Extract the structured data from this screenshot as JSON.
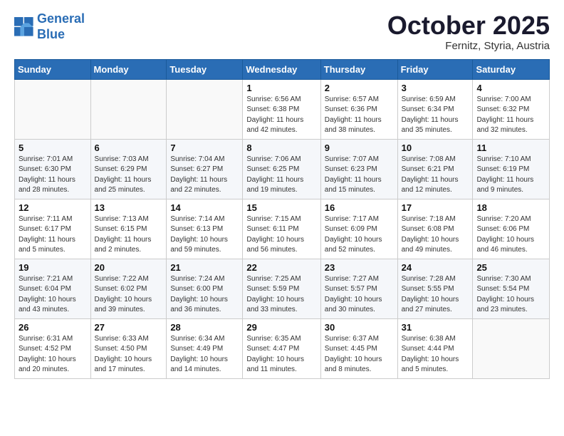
{
  "logo": {
    "line1": "General",
    "line2": "Blue"
  },
  "title": "October 2025",
  "subtitle": "Fernitz, Styria, Austria",
  "weekdays": [
    "Sunday",
    "Monday",
    "Tuesday",
    "Wednesday",
    "Thursday",
    "Friday",
    "Saturday"
  ],
  "weeks": [
    [
      {
        "day": "",
        "info": ""
      },
      {
        "day": "",
        "info": ""
      },
      {
        "day": "",
        "info": ""
      },
      {
        "day": "1",
        "info": "Sunrise: 6:56 AM\nSunset: 6:38 PM\nDaylight: 11 hours\nand 42 minutes."
      },
      {
        "day": "2",
        "info": "Sunrise: 6:57 AM\nSunset: 6:36 PM\nDaylight: 11 hours\nand 38 minutes."
      },
      {
        "day": "3",
        "info": "Sunrise: 6:59 AM\nSunset: 6:34 PM\nDaylight: 11 hours\nand 35 minutes."
      },
      {
        "day": "4",
        "info": "Sunrise: 7:00 AM\nSunset: 6:32 PM\nDaylight: 11 hours\nand 32 minutes."
      }
    ],
    [
      {
        "day": "5",
        "info": "Sunrise: 7:01 AM\nSunset: 6:30 PM\nDaylight: 11 hours\nand 28 minutes."
      },
      {
        "day": "6",
        "info": "Sunrise: 7:03 AM\nSunset: 6:29 PM\nDaylight: 11 hours\nand 25 minutes."
      },
      {
        "day": "7",
        "info": "Sunrise: 7:04 AM\nSunset: 6:27 PM\nDaylight: 11 hours\nand 22 minutes."
      },
      {
        "day": "8",
        "info": "Sunrise: 7:06 AM\nSunset: 6:25 PM\nDaylight: 11 hours\nand 19 minutes."
      },
      {
        "day": "9",
        "info": "Sunrise: 7:07 AM\nSunset: 6:23 PM\nDaylight: 11 hours\nand 15 minutes."
      },
      {
        "day": "10",
        "info": "Sunrise: 7:08 AM\nSunset: 6:21 PM\nDaylight: 11 hours\nand 12 minutes."
      },
      {
        "day": "11",
        "info": "Sunrise: 7:10 AM\nSunset: 6:19 PM\nDaylight: 11 hours\nand 9 minutes."
      }
    ],
    [
      {
        "day": "12",
        "info": "Sunrise: 7:11 AM\nSunset: 6:17 PM\nDaylight: 11 hours\nand 5 minutes."
      },
      {
        "day": "13",
        "info": "Sunrise: 7:13 AM\nSunset: 6:15 PM\nDaylight: 11 hours\nand 2 minutes."
      },
      {
        "day": "14",
        "info": "Sunrise: 7:14 AM\nSunset: 6:13 PM\nDaylight: 10 hours\nand 59 minutes."
      },
      {
        "day": "15",
        "info": "Sunrise: 7:15 AM\nSunset: 6:11 PM\nDaylight: 10 hours\nand 56 minutes."
      },
      {
        "day": "16",
        "info": "Sunrise: 7:17 AM\nSunset: 6:09 PM\nDaylight: 10 hours\nand 52 minutes."
      },
      {
        "day": "17",
        "info": "Sunrise: 7:18 AM\nSunset: 6:08 PM\nDaylight: 10 hours\nand 49 minutes."
      },
      {
        "day": "18",
        "info": "Sunrise: 7:20 AM\nSunset: 6:06 PM\nDaylight: 10 hours\nand 46 minutes."
      }
    ],
    [
      {
        "day": "19",
        "info": "Sunrise: 7:21 AM\nSunset: 6:04 PM\nDaylight: 10 hours\nand 43 minutes."
      },
      {
        "day": "20",
        "info": "Sunrise: 7:22 AM\nSunset: 6:02 PM\nDaylight: 10 hours\nand 39 minutes."
      },
      {
        "day": "21",
        "info": "Sunrise: 7:24 AM\nSunset: 6:00 PM\nDaylight: 10 hours\nand 36 minutes."
      },
      {
        "day": "22",
        "info": "Sunrise: 7:25 AM\nSunset: 5:59 PM\nDaylight: 10 hours\nand 33 minutes."
      },
      {
        "day": "23",
        "info": "Sunrise: 7:27 AM\nSunset: 5:57 PM\nDaylight: 10 hours\nand 30 minutes."
      },
      {
        "day": "24",
        "info": "Sunrise: 7:28 AM\nSunset: 5:55 PM\nDaylight: 10 hours\nand 27 minutes."
      },
      {
        "day": "25",
        "info": "Sunrise: 7:30 AM\nSunset: 5:54 PM\nDaylight: 10 hours\nand 23 minutes."
      }
    ],
    [
      {
        "day": "26",
        "info": "Sunrise: 6:31 AM\nSunset: 4:52 PM\nDaylight: 10 hours\nand 20 minutes."
      },
      {
        "day": "27",
        "info": "Sunrise: 6:33 AM\nSunset: 4:50 PM\nDaylight: 10 hours\nand 17 minutes."
      },
      {
        "day": "28",
        "info": "Sunrise: 6:34 AM\nSunset: 4:49 PM\nDaylight: 10 hours\nand 14 minutes."
      },
      {
        "day": "29",
        "info": "Sunrise: 6:35 AM\nSunset: 4:47 PM\nDaylight: 10 hours\nand 11 minutes."
      },
      {
        "day": "30",
        "info": "Sunrise: 6:37 AM\nSunset: 4:45 PM\nDaylight: 10 hours\nand 8 minutes."
      },
      {
        "day": "31",
        "info": "Sunrise: 6:38 AM\nSunset: 4:44 PM\nDaylight: 10 hours\nand 5 minutes."
      },
      {
        "day": "",
        "info": ""
      }
    ]
  ]
}
